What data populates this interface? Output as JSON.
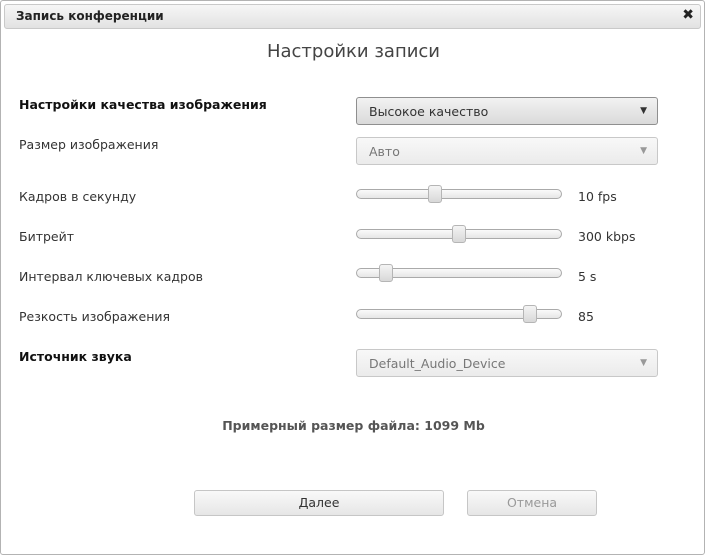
{
  "window": {
    "title": "Запись конференции",
    "close_icon": "close-icon"
  },
  "heading": "Настройки записи",
  "quality": {
    "label": "Настройки качества изображения",
    "selected": "Высокое качество"
  },
  "resolution": {
    "label": "Размер изображения",
    "selected": "Авто"
  },
  "fps": {
    "label": "Кадров в секунду",
    "value": "10 fps",
    "level": 0.38
  },
  "bitrate": {
    "label": "Битрейт",
    "value": "300 kbps",
    "level": 0.5
  },
  "keyframe": {
    "label": "Интервал ключевых кадров",
    "value": "5 s",
    "level": 0.14
  },
  "sharpness": {
    "label": "Резкость изображения",
    "value": "85",
    "level": 0.85
  },
  "audio": {
    "label": "Источник звука",
    "selected": "Default_Audio_Device"
  },
  "file_size": "Примерный размер файла: 1099 Mb",
  "buttons": {
    "next": "Далее",
    "cancel": "Отмена"
  }
}
